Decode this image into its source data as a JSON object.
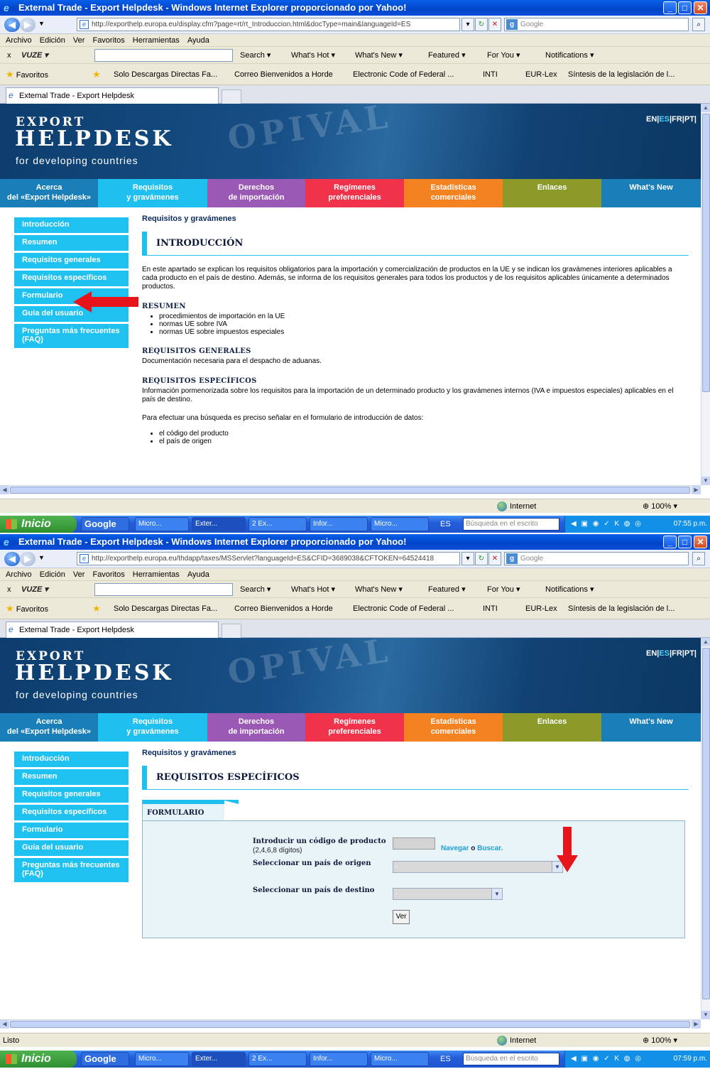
{
  "screens": [
    {
      "window_title": "External Trade - Export Helpdesk - Windows Internet Explorer proporcionado por Yahoo!",
      "url": "http://exporthelp.europa.eu/display.cfm?page=rt/rt_Introduccion.html&docType=main&languageId=ES",
      "status_left": "",
      "clock": "07:55 p.m.",
      "heading": "INTRODUCCIÓN"
    },
    {
      "window_title": "External Trade - Export Helpdesk - Windows Internet Explorer proporcionado por Yahoo!",
      "url": "http://exporthelp.europa.eu/thdapp/taxes/MSServlet?languageId=ES&CFID=3689038&CFTOKEN=64524418",
      "status_left": "Listo",
      "clock": "07:59 p.m.",
      "heading": "REQUISITOS ESPECÍFICOS"
    }
  ],
  "browser": {
    "google_placeholder": "Google",
    "menu": [
      "Archivo",
      "Edición",
      "Ver",
      "Favoritos",
      "Herramientas",
      "Ayuda"
    ],
    "vuze": {
      "close": "x",
      "logo": "VUZE",
      "items": [
        "Search ▾",
        "What's Hot ▾",
        "What's New ▾",
        "Featured ▾",
        "For You ▾",
        "Notifications ▾"
      ]
    },
    "favorites_label": "Favoritos",
    "favorites": [
      "Solo Descargas Directas Fa...",
      "Correo Bienvenidos a Horde",
      "Electronic Code of Federal ...",
      "INTI",
      "EUR-Lex",
      "Síntesis de la legislación de l..."
    ],
    "tab_title": "External Trade - Export Helpdesk",
    "zone": "Internet",
    "zoom": "100%"
  },
  "taskbar": {
    "start": "Inicio",
    "google": "Google",
    "buttons": [
      "Micro...",
      "Exter...",
      "2 Ex...",
      "Infor...",
      "Micro..."
    ],
    "lang": "ES",
    "search_placeholder": "Búsqueda en el escrito"
  },
  "site": {
    "logo_line1": "EXPORT",
    "logo_line2": "HELPDESK",
    "logo_line3": "for developing countries",
    "langs": [
      "EN",
      "ES",
      "FR",
      "PT"
    ],
    "active_lang": "ES",
    "nav": [
      {
        "l1": "Acerca",
        "l2": "del «Export Helpdesk»",
        "color": "#1a7fb8"
      },
      {
        "l1": "Requisitos",
        "l2": "y gravámenes",
        "color": "#1fc0f0"
      },
      {
        "l1": "Derechos",
        "l2": "de importación",
        "color": "#9b59b6"
      },
      {
        "l1": "Regímenes",
        "l2": "preferenciales",
        "color": "#f0334a"
      },
      {
        "l1": "Estadísticas",
        "l2": "comerciales",
        "color": "#f58220"
      },
      {
        "l1": "Enlaces",
        "l2": "",
        "color": "#8c9a2a"
      },
      {
        "l1": "What's New",
        "l2": "",
        "color": "#1a7fb8"
      }
    ],
    "leftnav": [
      "Introducción",
      "Resumen",
      "Requisitos generales",
      "Requisitos específicos",
      "Formulario",
      "Guía del usuario",
      "Preguntas más frecuentes (FAQ)"
    ],
    "breadcrumb": "Requisitos y gravámenes"
  },
  "intro": {
    "paragraph": "En este apartado se explican los requisitos obligatorios para la importación y comercialización de productos en la UE y se indican los gravámenes interiores aplicables a cada producto en el país de destino. Además, se informa de los requisitos generales para todos los productos y de los requisitos aplicables únicamente a determinados productos.",
    "resumen_title": "RESUMEN",
    "resumen_items": [
      "procedimientos de importación en la UE",
      "normas UE sobre IVA",
      "normas UE sobre impuestos especiales"
    ],
    "generales_title": "REQUISITOS GENERALES",
    "generales_text": "Documentación necesaria para el despacho de aduanas.",
    "especificos_title": "REQUISITOS ESPECÍFICOS",
    "especificos_text": "Información pormenorizada sobre los requisitos para la importación de un determinado producto y los gravámenes internos (IVA e impuestos especiales) aplicables en el país de destino.",
    "search_text": "Para efectuar una búsqueda es preciso señalar en el formulario de introducción de datos:",
    "search_items": [
      "el código del producto",
      "el país de origen"
    ]
  },
  "form": {
    "tab": "FORMULARIO",
    "code_label": "Introducir un código de producto",
    "code_hint": "(2,4,6,8 dígitos)",
    "browse": "Navegar",
    "or": "o",
    "search": "Buscar",
    "origin_label": "Seleccionar un país de origen",
    "origin_value": "-",
    "dest_label": "Seleccionar un país de destino",
    "dest_value": "-",
    "submit": "Ver"
  },
  "colors": {
    "accent": "#1fc0f0",
    "arrow": "#e8141c"
  }
}
